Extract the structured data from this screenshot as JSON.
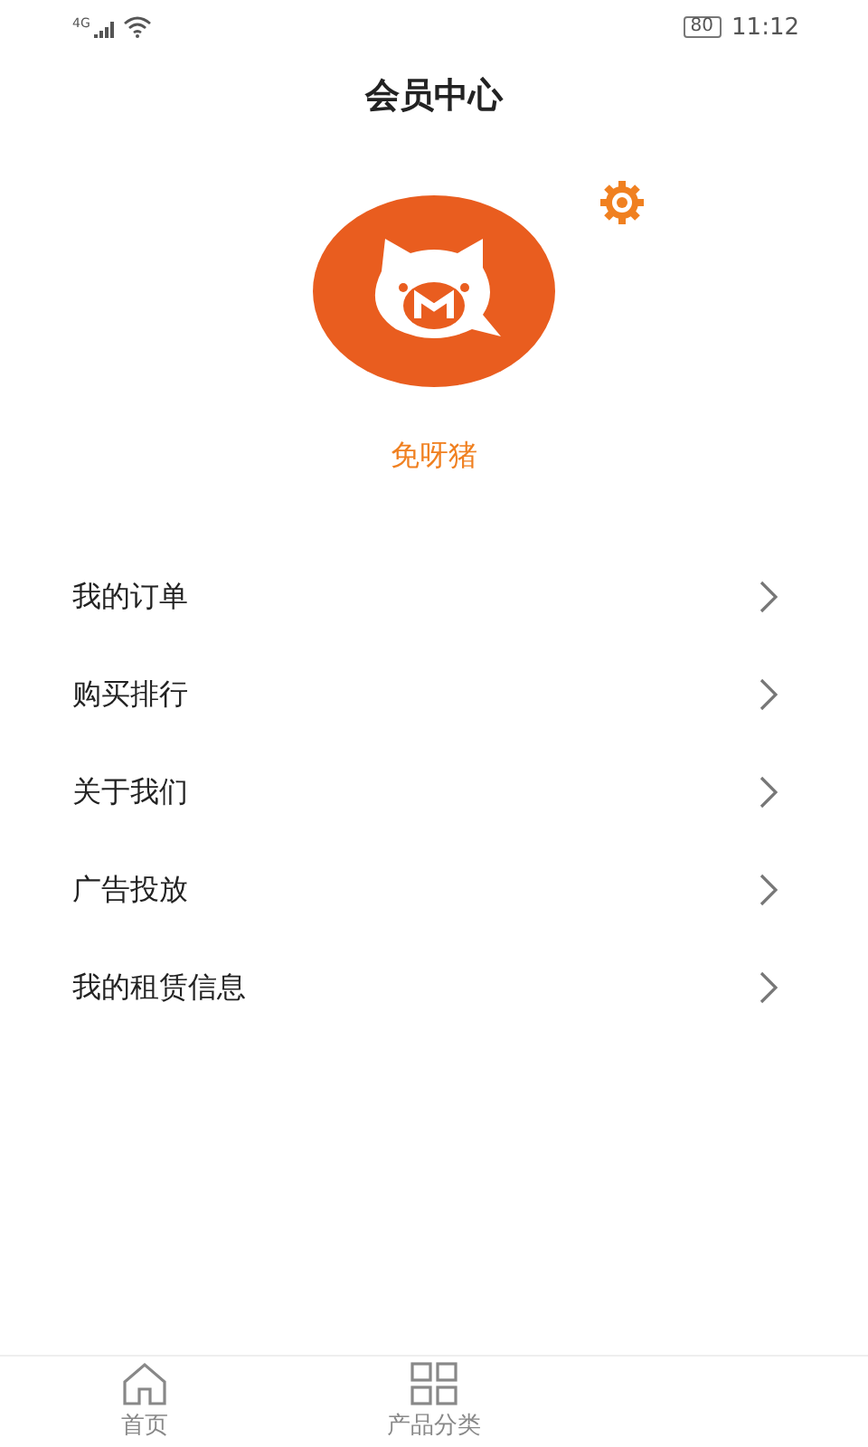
{
  "status_bar": {
    "network": "4G",
    "battery": "80",
    "time": "11:12"
  },
  "header": {
    "title": "会员中心"
  },
  "profile": {
    "name": "免呀猪"
  },
  "menu": [
    {
      "label": "我的订单"
    },
    {
      "label": "购买排行"
    },
    {
      "label": "关于我们"
    },
    {
      "label": "广告投放"
    },
    {
      "label": "我的租赁信息"
    }
  ],
  "tab_bar": [
    {
      "kind": "home",
      "label": "首页",
      "selected": false
    },
    {
      "kind": "grid",
      "label": "产品分类",
      "selected": false
    }
  ]
}
